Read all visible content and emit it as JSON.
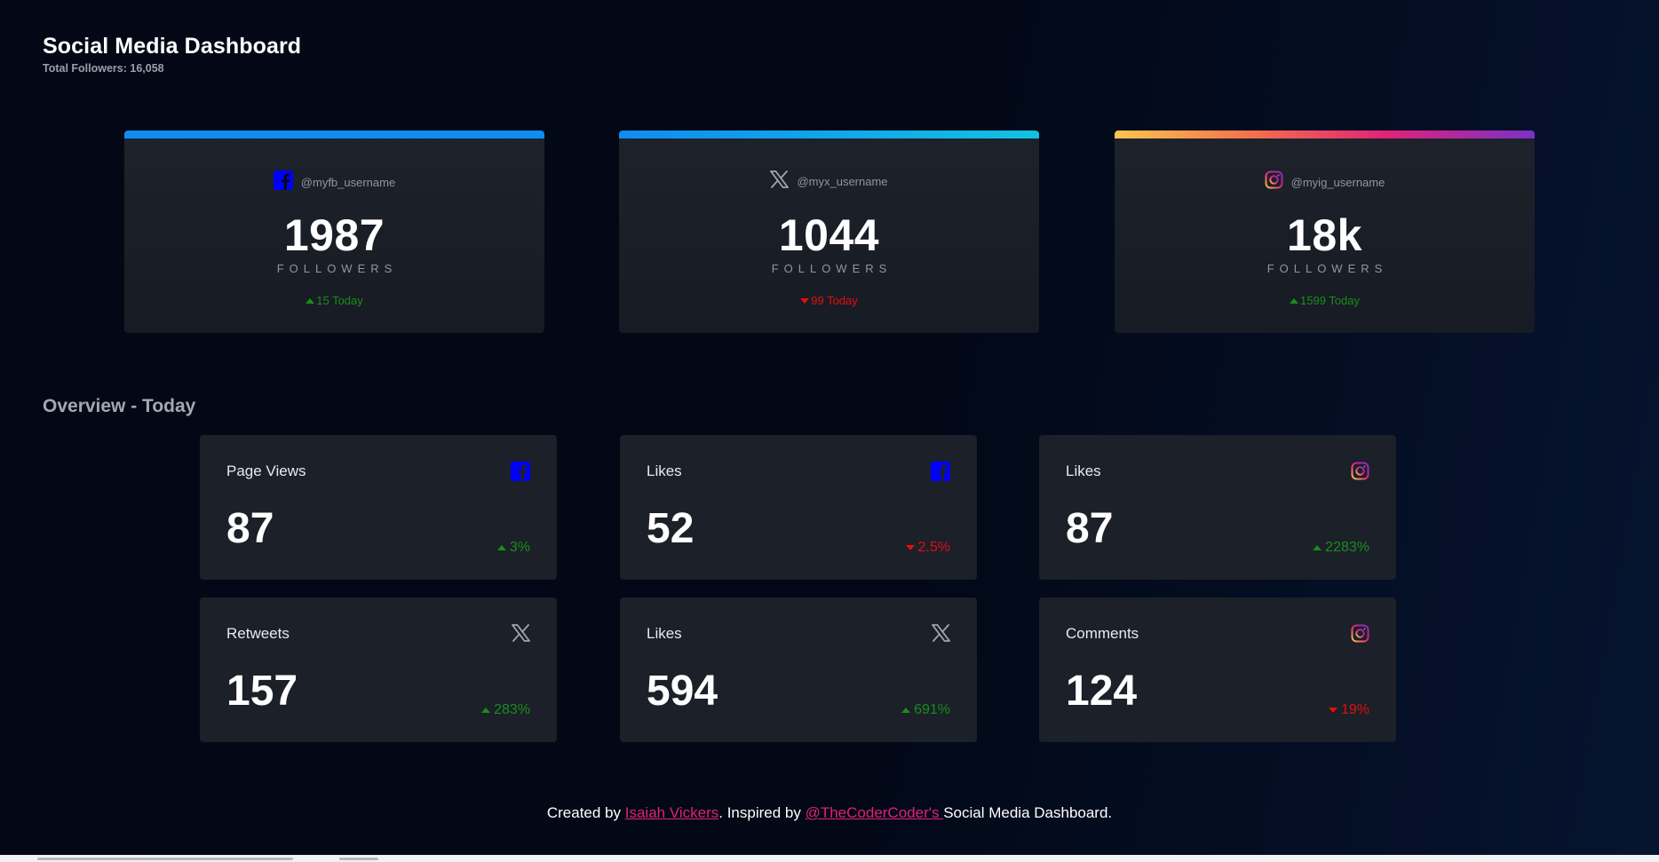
{
  "header": {
    "title": "Social Media Dashboard",
    "total_followers": "Total Followers: 16,058"
  },
  "colors": {
    "background": "#020816",
    "card": "#1b2029",
    "facebook_accent": "#0f8cf2",
    "twitter_accent": "#12c1e3",
    "instagram_accent_start": "#fbc54d",
    "instagram_accent_end": "#7a31c8",
    "up": "#1a8d1a",
    "down": "#e10f0f",
    "link": "#e0227a",
    "facebook_icon": "#0000ff"
  },
  "follower_cards": [
    {
      "network": "facebook",
      "icon": "facebook-icon",
      "handle": "@myfb_username",
      "count": "1987",
      "label": "FOLLOWERS",
      "trend": "up",
      "today": "15 Today"
    },
    {
      "network": "x",
      "icon": "x-icon",
      "handle": "@myx_username",
      "count": "1044",
      "label": "FOLLOWERS",
      "trend": "down",
      "today": "99 Today"
    },
    {
      "network": "instagram",
      "icon": "instagram-icon",
      "handle": "@myig_username",
      "count": "18k",
      "label": "FOLLOWERS",
      "trend": "up",
      "today": "1599 Today"
    }
  ],
  "overview": {
    "title": "Overview - Today",
    "tiles": [
      {
        "metric": "Page Views",
        "icon": "facebook-icon",
        "value": "87",
        "trend": "up",
        "percent": "3%"
      },
      {
        "metric": "Likes",
        "icon": "facebook-icon",
        "value": "52",
        "trend": "down",
        "percent": "2.5%"
      },
      {
        "metric": "Likes",
        "icon": "instagram-icon",
        "value": "87",
        "trend": "up",
        "percent": "2283%"
      },
      {
        "metric": "Retweets",
        "icon": "x-icon",
        "value": "157",
        "trend": "up",
        "percent": "283%"
      },
      {
        "metric": "Likes",
        "icon": "x-icon",
        "value": "594",
        "trend": "up",
        "percent": "691%"
      },
      {
        "metric": "Comments",
        "icon": "instagram-icon",
        "value": "124",
        "trend": "down",
        "percent": "19%"
      }
    ]
  },
  "footer": {
    "prefix": "Created by ",
    "author": "Isaiah Vickers",
    "middle": ". Inspired by ",
    "inspiration": "@TheCoderCoder's ",
    "suffix": "Social Media Dashboard."
  }
}
